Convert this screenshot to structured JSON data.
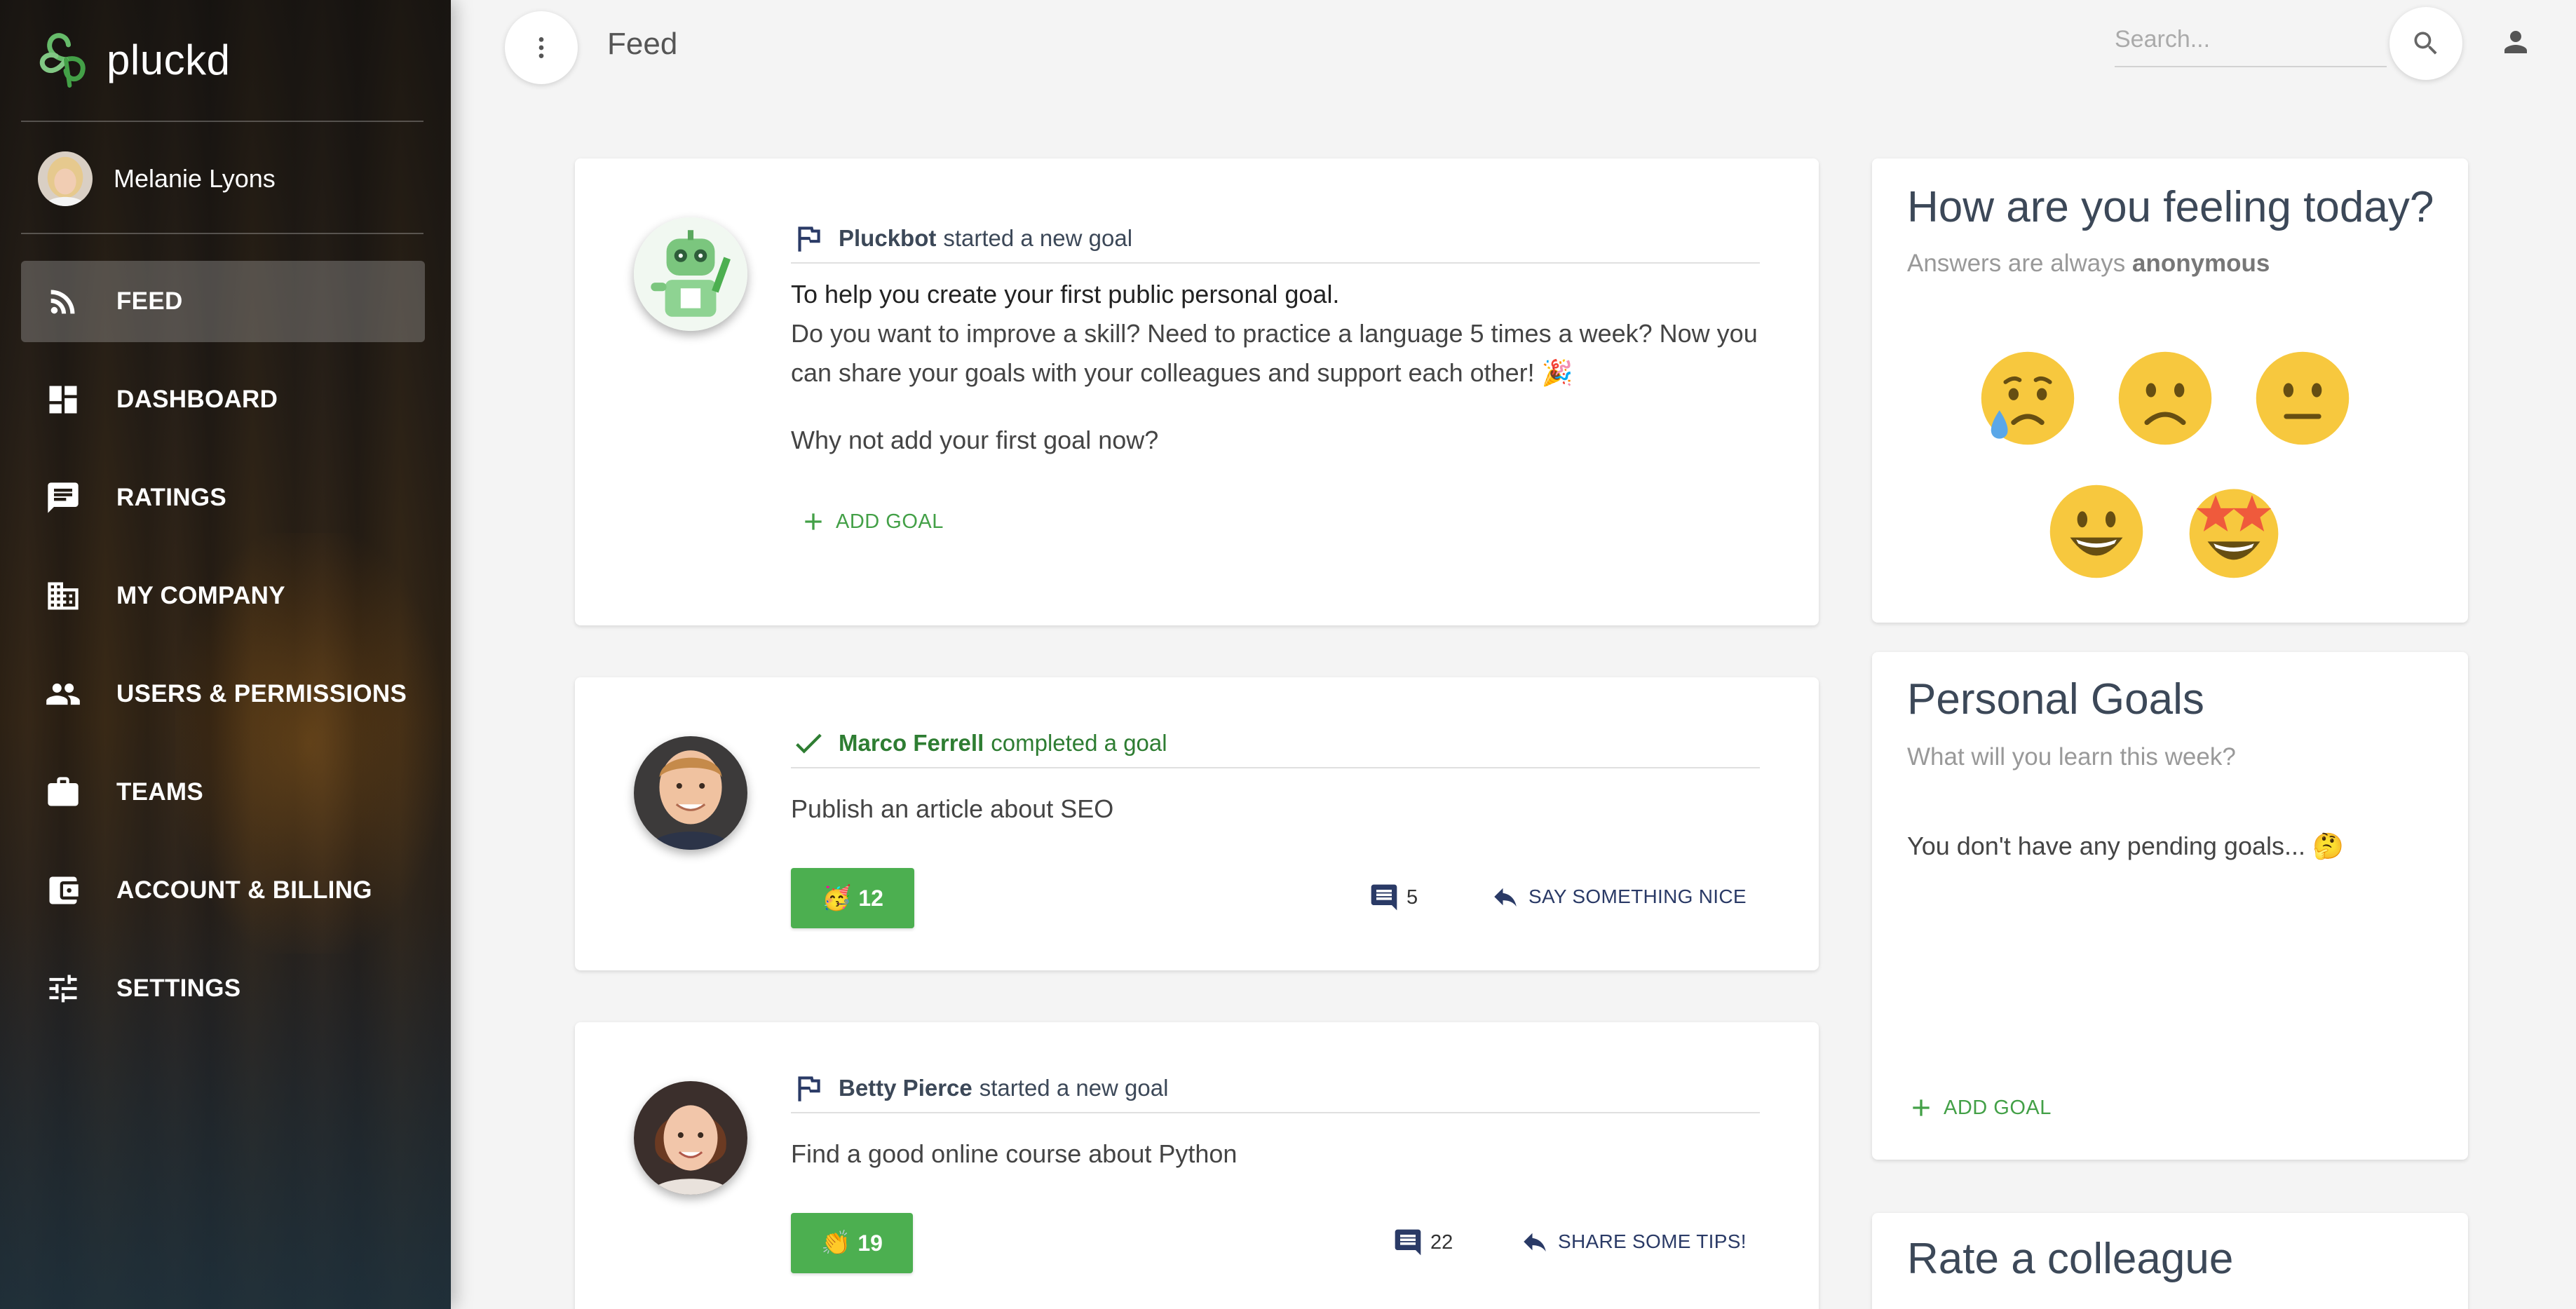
{
  "brand": {
    "name": "pluckd"
  },
  "user": {
    "name": "Melanie Lyons"
  },
  "nav": [
    {
      "label": "FEED",
      "icon": "rss-icon",
      "active": true
    },
    {
      "label": "DASHBOARD",
      "icon": "dashboard-icon"
    },
    {
      "label": "RATINGS",
      "icon": "ratings-icon"
    },
    {
      "label": "MY COMPANY",
      "icon": "building-icon"
    },
    {
      "label": "USERS & PERMISSIONS",
      "icon": "people-icon"
    },
    {
      "label": "TEAMS",
      "icon": "briefcase-icon"
    },
    {
      "label": "ACCOUNT & BILLING",
      "icon": "wallet-icon"
    },
    {
      "label": "SETTINGS",
      "icon": "sliders-icon"
    }
  ],
  "header": {
    "title": "Feed",
    "search_placeholder": "Search..."
  },
  "feed": [
    {
      "author": "Pluckbot",
      "action": "started a new goal",
      "icon": "flag-icon",
      "body_strong": "To help you create your first public personal goal.",
      "body": "Do you want to improve a skill? Need to practice a language 5 times a week? Now you can share your goals with your colleagues and support each other! 🎉",
      "question": "Why not add your first goal now?",
      "button": "ADD GOAL"
    },
    {
      "author": "Marco Ferrell",
      "action": "completed a goal",
      "icon": "check-icon",
      "body": "Publish an article about SEO",
      "kudos_emoji": "🥳",
      "kudos_count": "12",
      "comments": "5",
      "reply_label": "SAY SOMETHING NICE"
    },
    {
      "author": "Betty Pierce",
      "action": "started a new goal",
      "icon": "flag-icon",
      "body": "Find a good online course about Python",
      "kudos_emoji": "👏",
      "kudos_count": "19",
      "comments": "22",
      "reply_label": "SHARE SOME TIPS!"
    }
  ],
  "mood": {
    "title": "How are you feeling today?",
    "subtitle_prefix": "Answers are always",
    "subtitle_bold": "anonymous",
    "options": [
      "crying",
      "frowning",
      "neutral",
      "smiling",
      "star-struck"
    ]
  },
  "goals": {
    "title": "Personal Goals",
    "subtitle": "What will you learn this week?",
    "empty": "You don't have any pending goals... 🤔",
    "button": "ADD GOAL"
  },
  "rate": {
    "title": "Rate a colleague"
  },
  "colors": {
    "accent_green": "#4caf50",
    "text_green": "#2e7d32",
    "navy": "#2a3a66",
    "emoji_yellow": "#f7c83e"
  }
}
